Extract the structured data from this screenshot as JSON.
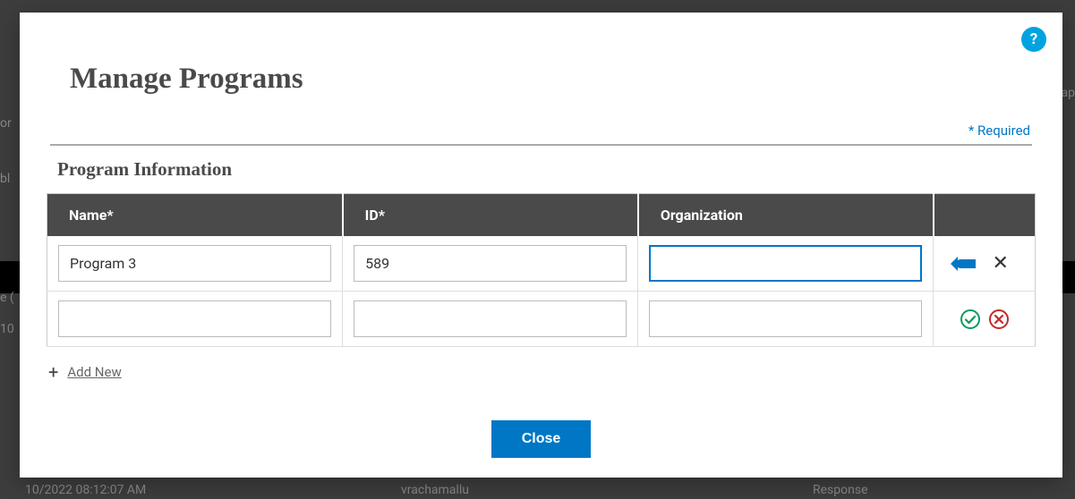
{
  "backdrop": {
    "top_right": "ap",
    "left_or": "or",
    "left_bl": "bl",
    "left_eq": "e (",
    "left_10": "10",
    "bottom_date": "10/2022 08:12:07 AM",
    "bottom_user": "vrachamallu",
    "bottom_resp": "Response"
  },
  "modal": {
    "title": "Manage Programs",
    "help_label": "?",
    "required_label": "* Required",
    "section_title": "Program Information",
    "columns": {
      "name": "Name*",
      "id": "ID*",
      "organization": "Organization"
    },
    "rows": [
      {
        "name": "Program 3",
        "id": "589",
        "organization": ""
      },
      {
        "name": "",
        "id": "",
        "organization": ""
      }
    ],
    "add_new_label": "Add New",
    "close_label": "Close"
  }
}
